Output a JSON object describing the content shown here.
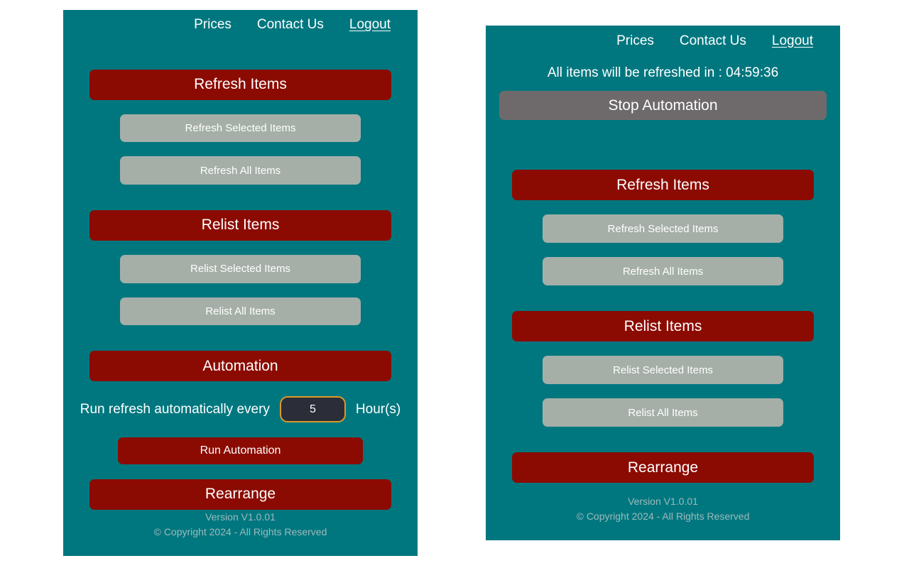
{
  "colors": {
    "panel_background": "#00777F",
    "primary_button": "#8B0B02",
    "secondary_button": "#A5AFA8",
    "stop_button": "#6E6A6B",
    "input_background": "#2B2D38",
    "input_border": "#D99A2B",
    "footer_text": "#9DB9BC",
    "page_background": "#FFFFFF"
  },
  "nav": {
    "prices": "Prices",
    "contact_us": "Contact Us",
    "logout": "Logout"
  },
  "left_panel": {
    "refresh_section": {
      "header": "Refresh Items",
      "selected": "Refresh Selected Items",
      "all": "Refresh All Items"
    },
    "relist_section": {
      "header": "Relist Items",
      "selected": "Relist Selected Items",
      "all": "Relist All Items"
    },
    "automation_section": {
      "header": "Automation",
      "label_before": "Run refresh automatically every",
      "interval_value": "5",
      "interval_placeholder": "5",
      "label_after": "Hour(s)",
      "run_button": "Run Automation"
    },
    "rearrange_button": "Rearrange",
    "footer": {
      "version": "Version V1.0.01",
      "copyright": "© Copyright 2024 - All Rights Reserved"
    }
  },
  "right_panel": {
    "countdown": "All items will be refreshed in : 04:59:36",
    "stop_button": "Stop Automation",
    "refresh_section": {
      "header": "Refresh Items",
      "selected": "Refresh Selected Items",
      "all": "Refresh All Items"
    },
    "relist_section": {
      "header": "Relist Items",
      "selected": "Relist Selected Items",
      "all": "Relist All Items"
    },
    "rearrange_button": "Rearrange",
    "footer": {
      "version": "Version V1.0.01",
      "copyright": "© Copyright 2024 - All Rights Reserved"
    }
  }
}
